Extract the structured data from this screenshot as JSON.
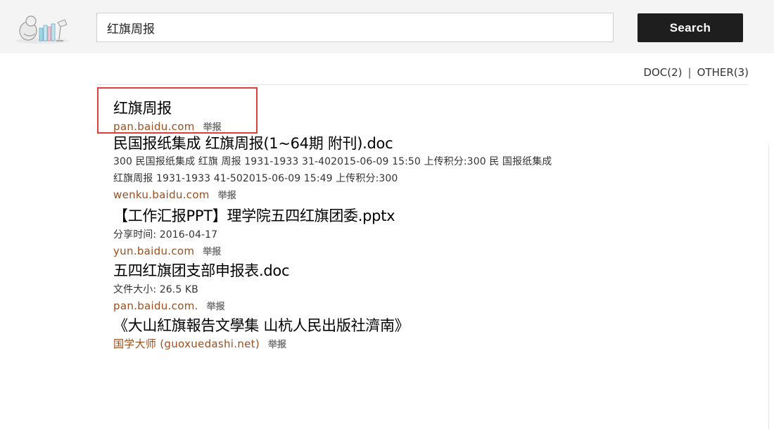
{
  "header": {
    "search": {
      "value": "红旗周报",
      "button_label": "Search"
    },
    "logo": {
      "icon": "books-lamp-logo-icon"
    }
  },
  "filters": {
    "doc": "DOC(2)",
    "separator": "|",
    "other": "OTHER(3)"
  },
  "results": [
    {
      "title": "红旗周报",
      "url": "pan.baidu.com",
      "report": "举报"
    },
    {
      "title": "民国报纸集成 红旗周报(1~64期 附刊).doc",
      "desc_lines": [
        "300 民国报纸集成 红旗 周报 1931-1933 31-402015-06-09 15:50 上传积分:300 民 国报纸集成",
        "红旗周报 1931-1933 41-502015-06-09 15:49 上传积分:300"
      ],
      "url": "wenku.baidu.com",
      "report": "举报"
    },
    {
      "title": "【工作汇报PPT】理学院五四红旗团委.pptx",
      "desc_lines": [
        "分享时间: 2016-04-17"
      ],
      "url": "yun.baidu.com",
      "report": "举报"
    },
    {
      "title": "五四红旗团支部申报表.doc",
      "desc_lines": [
        "文件大小: 26.5 KB"
      ],
      "url": "pan.baidu.com.",
      "report": "举报"
    },
    {
      "title": "《大山紅旗報告文學集 山杭人民出版社濟南》",
      "url": "国学大师 (guoxuedashi.net)",
      "report": "举报"
    }
  ],
  "colors": {
    "header_bg": "#f4f4f4",
    "button_bg": "#1e1e1e",
    "url_color": "#9a4f1f",
    "highlight_border": "#d9403a"
  }
}
